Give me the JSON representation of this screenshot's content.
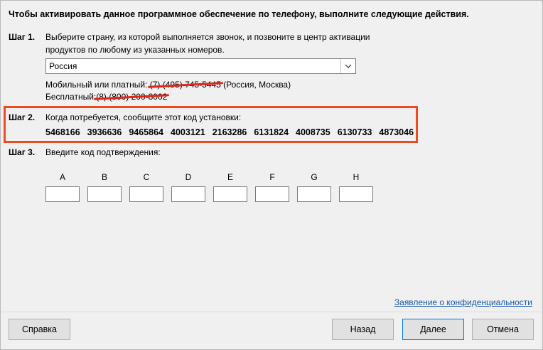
{
  "title": "Чтобы активировать данное программное обеспечение по телефону, выполните следующие действия.",
  "step1": {
    "label": "Шаг 1.",
    "text_line1": "Выберите страну, из которой выполняется звонок, и позвоните в центр активации",
    "text_line2": "продуктов по любому из указанных номеров.",
    "country": "Россия",
    "mobile_label": "Мобильный или платный:",
    "mobile_number": "(7) (495) 745-5445",
    "mobile_location": "(Россия, Москва)",
    "free_label": "Бесплатный:",
    "free_number": "(8) (800) 200-8002"
  },
  "step2": {
    "label": "Шаг 2.",
    "text": "Когда потребуется, сообщите этот код установки:",
    "codes": [
      "5468166",
      "3936636",
      "9465864",
      "4003121",
      "2163286",
      "6131824",
      "4008735",
      "6130733",
      "4873046"
    ]
  },
  "step3": {
    "label": "Шаг 3.",
    "text": "Введите код подтверждения:",
    "fields": [
      "A",
      "B",
      "C",
      "D",
      "E",
      "F",
      "G",
      "H"
    ]
  },
  "privacy_link": "Заявление о конфиденциальности",
  "buttons": {
    "help": "Справка",
    "back": "Назад",
    "next": "Далее",
    "cancel": "Отмена"
  },
  "colors": {
    "highlight": "#f04a1f",
    "strike": "#e3261a",
    "link": "#1a5aa8"
  }
}
